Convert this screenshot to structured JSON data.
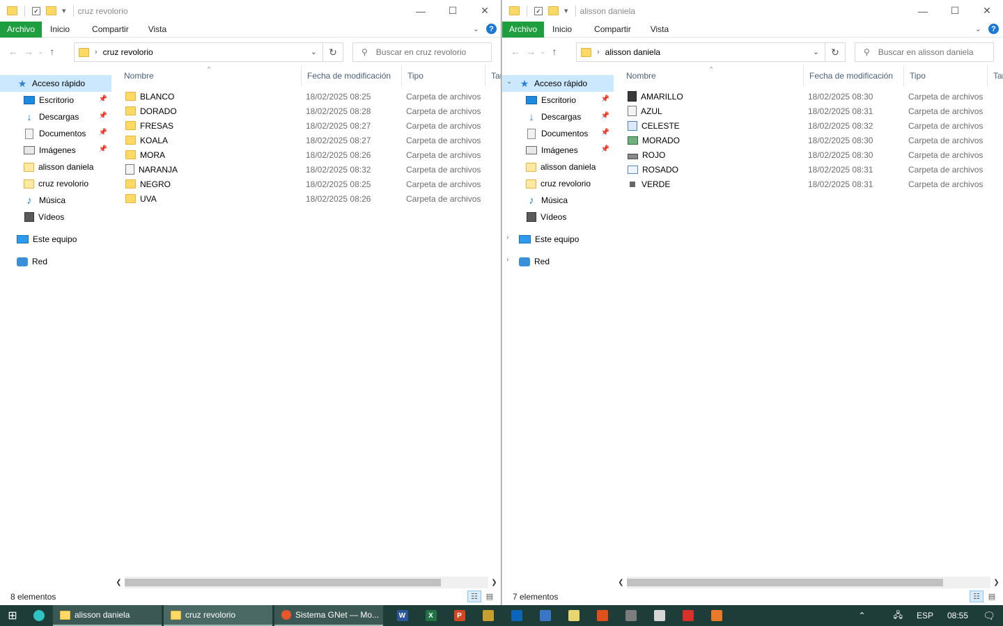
{
  "left": {
    "title": "cruz revolorio",
    "ribbon_tabs": [
      "Archivo",
      "Inicio",
      "Compartir",
      "Vista"
    ],
    "address": "cruz revolorio",
    "search_placeholder": "Buscar en cruz revolorio",
    "nav": {
      "quick_access": "Acceso rápido",
      "pinned": [
        "Escritorio",
        "Descargas",
        "Documentos",
        "Imágenes"
      ],
      "folders": [
        "alisson daniela",
        "cruz revolorio"
      ],
      "music": "Música",
      "videos": "Vídeos",
      "this_pc": "Este equipo",
      "network": "Red"
    },
    "columns": {
      "name": "Nombre",
      "date": "Fecha de modificación",
      "type": "Tipo",
      "size": "Tar"
    },
    "rows": [
      {
        "name": "BLANCO",
        "date": "18/02/2025 08:25",
        "type": "Carpeta de archivos",
        "icon": "folder-icon"
      },
      {
        "name": "DORADO",
        "date": "18/02/2025 08:28",
        "type": "Carpeta de archivos",
        "icon": "folder-icon"
      },
      {
        "name": "FRESAS",
        "date": "18/02/2025 08:27",
        "type": "Carpeta de archivos",
        "icon": "folder-icon"
      },
      {
        "name": "KOALA",
        "date": "18/02/2025 08:27",
        "type": "Carpeta de archivos",
        "icon": "folder-icon"
      },
      {
        "name": "MORA",
        "date": "18/02/2025 08:26",
        "type": "Carpeta de archivos",
        "icon": "folder-icon"
      },
      {
        "name": "NARANJA",
        "date": "18/02/2025 08:32",
        "type": "Carpeta de archivos",
        "icon": "document-folder-icon"
      },
      {
        "name": "NEGRO",
        "date": "18/02/2025 08:25",
        "type": "Carpeta de archivos",
        "icon": "folder-icon"
      },
      {
        "name": "UVA",
        "date": "18/02/2025 08:26",
        "type": "Carpeta de archivos",
        "icon": "folder-icon"
      }
    ],
    "status": "8 elementos",
    "scroll_fraction": 0.87
  },
  "right": {
    "title": "alisson daniela",
    "ribbon_tabs": [
      "Archivo",
      "Inicio",
      "Compartir",
      "Vista"
    ],
    "address": "alisson daniela",
    "search_placeholder": "Buscar en alisson daniela",
    "nav": {
      "quick_access": "Acceso rápido",
      "pinned": [
        "Escritorio",
        "Descargas",
        "Documentos",
        "Imágenes"
      ],
      "folders": [
        "alisson daniela",
        "cruz revolorio"
      ],
      "music": "Música",
      "videos": "Vídeos",
      "this_pc": "Este equipo",
      "network": "Red"
    },
    "columns": {
      "name": "Nombre",
      "date": "Fecha de modificación",
      "type": "Tipo",
      "size": "Tar"
    },
    "rows": [
      {
        "name": "AMARILLO",
        "date": "18/02/2025 08:30",
        "type": "Carpeta de archivos",
        "icon": "dark-file-icon"
      },
      {
        "name": "AZUL",
        "date": "18/02/2025 08:31",
        "type": "Carpeta de archivos",
        "icon": "document-icon"
      },
      {
        "name": "CELESTE",
        "date": "18/02/2025 08:32",
        "type": "Carpeta de archivos",
        "icon": "image-file-icon"
      },
      {
        "name": "MORADO",
        "date": "18/02/2025 08:30",
        "type": "Carpeta de archivos",
        "icon": "green-file-icon"
      },
      {
        "name": "ROJO",
        "date": "18/02/2025 08:30",
        "type": "Carpeta de archivos",
        "icon": "drive-icon"
      },
      {
        "name": "ROSADO",
        "date": "18/02/2025 08:31",
        "type": "Carpeta de archivos",
        "icon": "card-icon"
      },
      {
        "name": "VERDE",
        "date": "18/02/2025 08:31",
        "type": "Carpeta de archivos",
        "icon": "small-file-icon"
      }
    ],
    "status": "7 elementos",
    "scroll_fraction": 0.87
  },
  "taskbar": {
    "apps": [
      "alisson daniela",
      "cruz revolorio",
      "Sistema GNet — Mo..."
    ],
    "language": "ESP",
    "time": "08:55"
  },
  "colors": {
    "file_tab": "#1e9e3e",
    "selection": "#cce8ff",
    "taskbar": "#1f3d38"
  }
}
